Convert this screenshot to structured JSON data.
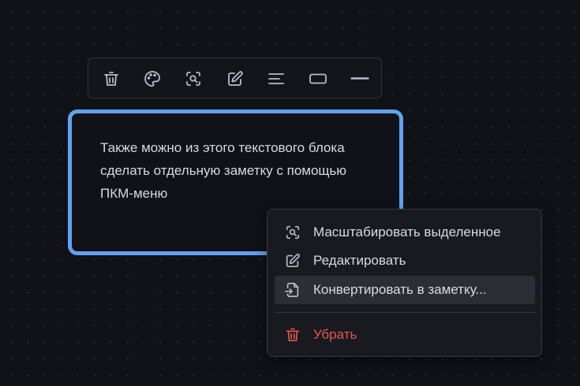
{
  "toolbar": {
    "buttons": [
      {
        "icon": "trash-icon",
        "action": "delete"
      },
      {
        "icon": "palette-icon",
        "action": "color"
      },
      {
        "icon": "zoom-selection-icon",
        "action": "zoom"
      },
      {
        "icon": "edit-icon",
        "action": "edit"
      },
      {
        "icon": "align-left-icon",
        "action": "text-align"
      },
      {
        "icon": "rectangle-shape-icon",
        "action": "shape"
      },
      {
        "icon": "line-icon",
        "action": "stroke"
      }
    ]
  },
  "text_block": {
    "text": "Также можно из этого текстового блока сделать отдельную заметку с помощью ПКМ-меню",
    "border_color": "#63a1f2"
  },
  "context_menu": {
    "items": [
      {
        "label": "Масштабировать выделенное",
        "icon": "zoom-selection-icon"
      },
      {
        "label": "Редактировать",
        "icon": "edit-icon"
      },
      {
        "label": "Конвертировать в заметку...",
        "icon": "file-import-icon",
        "highlighted": true
      },
      {
        "label": "Убрать",
        "icon": "trash-icon",
        "danger": true
      }
    ]
  },
  "colors": {
    "background": "#101218",
    "accent": "#63a1f2",
    "danger": "#e5594d",
    "text": "#d8dadf"
  }
}
